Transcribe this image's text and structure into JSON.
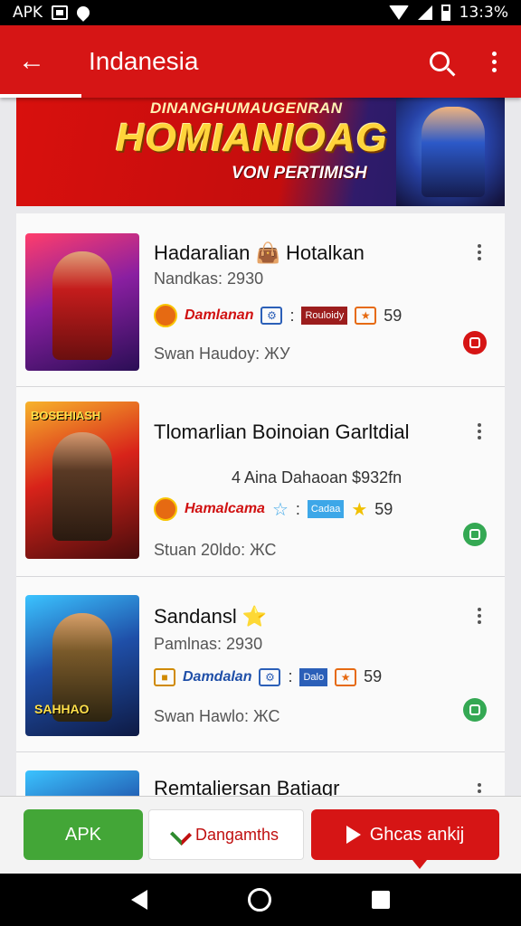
{
  "status_bar": {
    "left_text": "APK",
    "time": "13:3%"
  },
  "app_bar": {
    "title": "Indanesia"
  },
  "banner": {
    "top_text": "DINANGHUMAUGENRAN",
    "headline": "HOMIANIOAG",
    "subtitle": "VON PERTIMISH"
  },
  "apps": [
    {
      "name": "Hadaralian 👜 Hotalkan",
      "subtitle": "Nandkas: 2930",
      "chip_logo": "Damlanan",
      "chip_tag": "Rouloidy",
      "chip_num": "59",
      "footer": "Swan Haudoy: ЖУ",
      "status": "red",
      "thumb_tag": ""
    },
    {
      "name": "Tlomarlian Boinoian Garltdial",
      "subtitle": "4 Aina Dahaoan $932fn",
      "chip_logo": "Hamalcama",
      "chip_tag": "Cadaa",
      "chip_num": "59",
      "footer": "Stuan 20ldo: ЖС",
      "status": "green",
      "thumb_tag": "BOSEHIASH"
    },
    {
      "name": "Sandansl ⭐",
      "subtitle": "Pamlnas: 2930",
      "chip_logo": "Damdalan",
      "chip_tag": "Dalo",
      "chip_num": "59",
      "footer": "Swan Hawlo: ЖС",
      "status": "green",
      "thumb_tag": "SАННАО"
    },
    {
      "name": "Remtaliersan Batiagr",
      "subtitle": "",
      "chip_logo": "",
      "chip_tag": "",
      "chip_num": "",
      "footer": "",
      "status": "",
      "thumb_tag": ""
    }
  ],
  "bottom_bar": {
    "apk_label": "APK",
    "download_label": "Dangamths",
    "share_label": "Ghcas ankij"
  },
  "colors": {
    "brand_red": "#d61515",
    "green": "#43a637"
  }
}
